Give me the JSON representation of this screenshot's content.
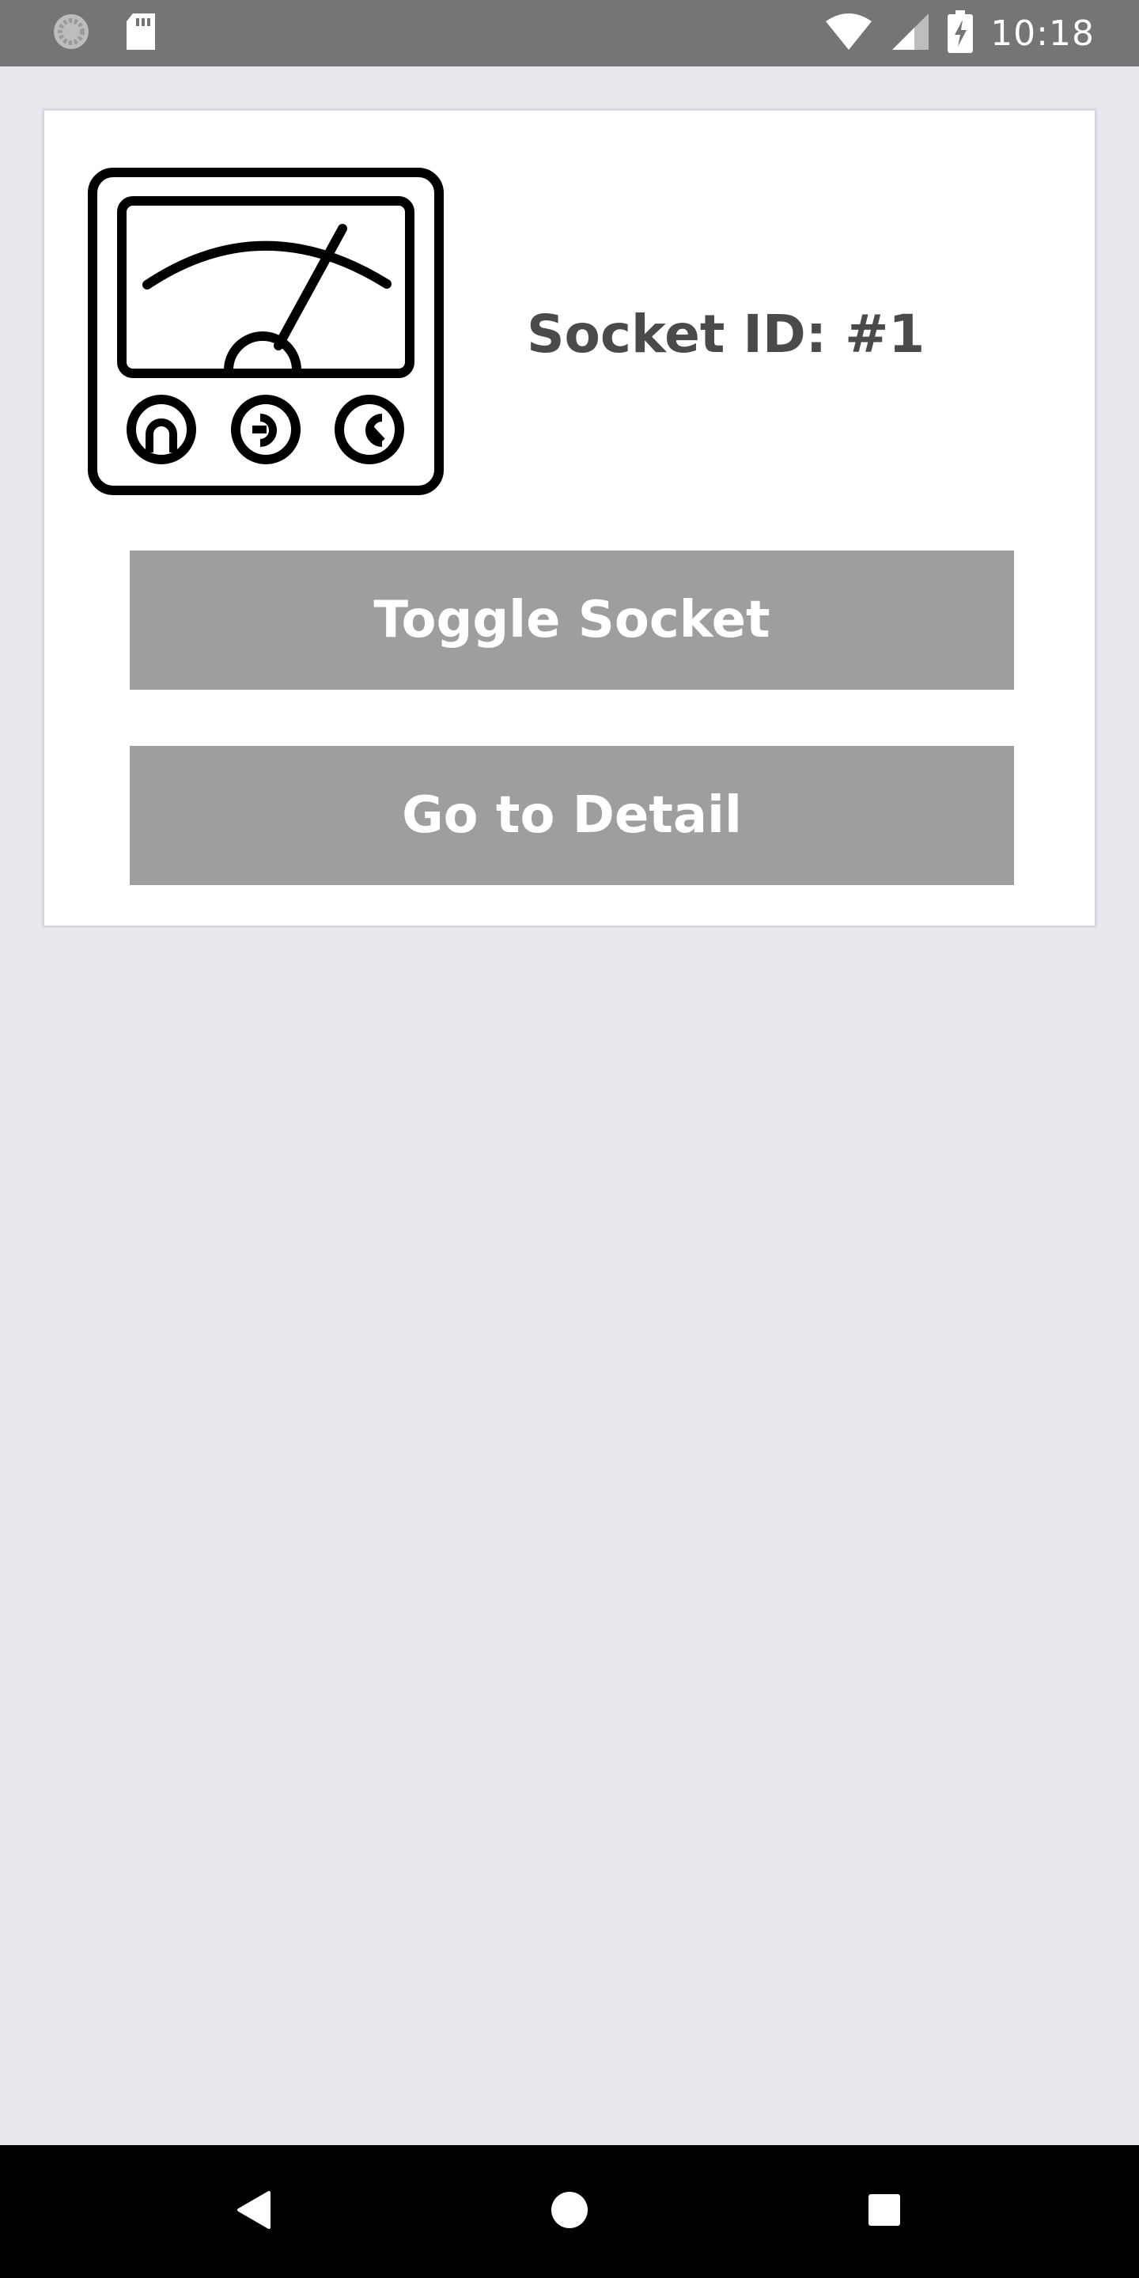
{
  "status_bar": {
    "time": "10:18",
    "icons": [
      "sync-icon",
      "sd-card-icon",
      "wifi-icon",
      "cell-signal-icon",
      "battery-charging-icon"
    ]
  },
  "card": {
    "socket_id": "Socket ID: #1",
    "icon": "meter-icon",
    "buttons": {
      "toggle_label": "Toggle Socket",
      "detail_label": "Go to Detail"
    }
  },
  "nav_bar": {
    "icons": [
      "back-icon",
      "home-icon",
      "recents-icon"
    ]
  },
  "colors": {
    "status_bar": "#757575",
    "background": "#e9e8ee",
    "card": "#ffffff",
    "button": "#9e9e9e",
    "button_text": "#ffffff",
    "label_text": "#4a4a4a",
    "nav_bar": "#000000"
  }
}
